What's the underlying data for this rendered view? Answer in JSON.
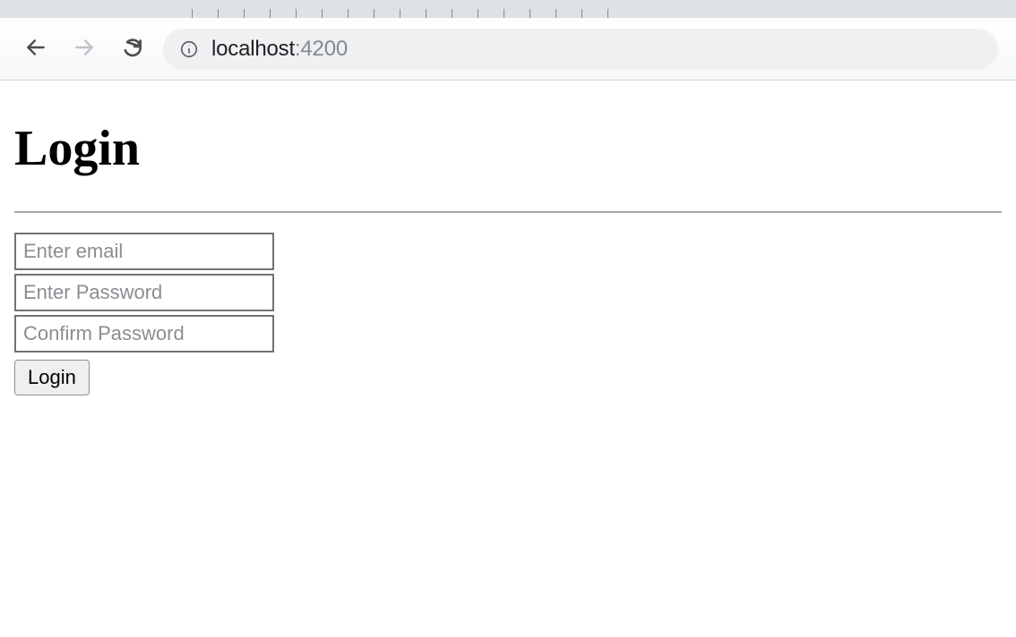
{
  "browser": {
    "url_host": "localhost",
    "url_port": ":4200"
  },
  "page": {
    "title": "Login"
  },
  "form": {
    "email_placeholder": "Enter email",
    "password_placeholder": "Enter Password",
    "confirm_password_placeholder": "Confirm Password",
    "login_button_label": "Login"
  }
}
